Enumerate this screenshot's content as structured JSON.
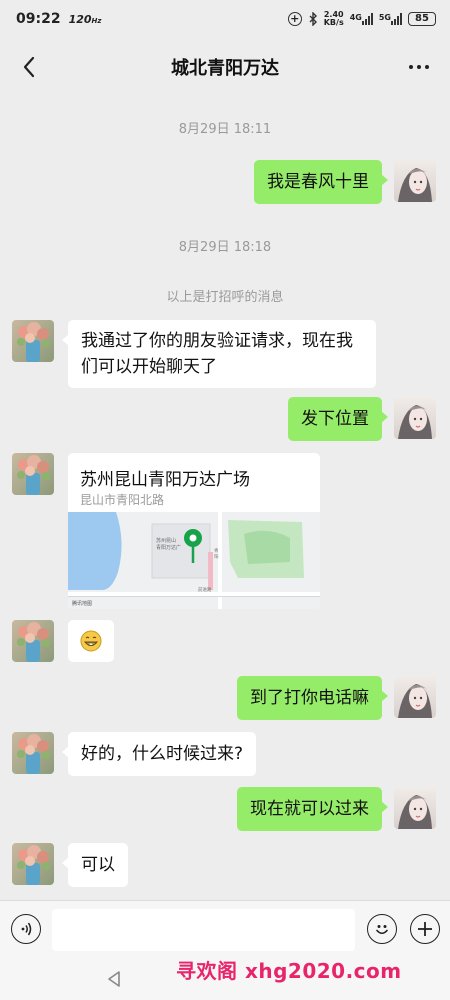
{
  "status_bar": {
    "time": "09:22",
    "refresh_rate": "120",
    "refresh_unit": "Hz",
    "speed_value": "2.40",
    "speed_unit": "KB/s",
    "network_1": "4G",
    "network_2": "5G",
    "battery": "85",
    "icons": [
      "alarm-plus-icon",
      "bluetooth-icon",
      "signal-icon",
      "battery-icon"
    ]
  },
  "header": {
    "title": "城北青阳万达",
    "back_icon": "chevron-left-icon",
    "more_icon": "more-dots-icon"
  },
  "chat": {
    "timestamp_1": "8月29日 18:11",
    "msg_out_1": "我是春风十里",
    "timestamp_2": "8月29日 18:18",
    "system_notice": "以上是打招呼的消息",
    "msg_in_1": "我通过了你的朋友验证请求，现在我们可以开始聊天了",
    "msg_in_1_line1": "我通过了你的朋友验证请求，现在我",
    "msg_in_1_line2": "们可以开始聊天了",
    "msg_out_2": "发下位置",
    "location": {
      "name": "苏州昆山青阳万达广场",
      "address": "昆山市青阳北路",
      "map_label_road_1": "青阳北路",
      "map_label_road_2": "前进路",
      "map_label_poi": "苏州昆山青阳万达广场",
      "map_provider": "腾讯地图"
    },
    "msg_in_2": "😁",
    "msg_out_3": "到了打你电话嘛",
    "msg_in_3": "好的，什么时候过来?",
    "msg_out_4": "现在就可以过来",
    "msg_in_4": "可以"
  },
  "input_bar": {
    "voice_icon": "voice-icon",
    "input_value": "",
    "emoji_icon": "emoji-icon",
    "add_icon": "plus-icon"
  },
  "nav_bar": {
    "back_icon": "triangle-back-icon"
  },
  "watermark": "寻欢阁 xhg2020.com",
  "colors": {
    "background": "#ededed",
    "outgoing_bubble": "#95ec69",
    "incoming_bubble": "#ffffff",
    "map_pin": "#16a34a",
    "watermark": "#e8256b"
  }
}
